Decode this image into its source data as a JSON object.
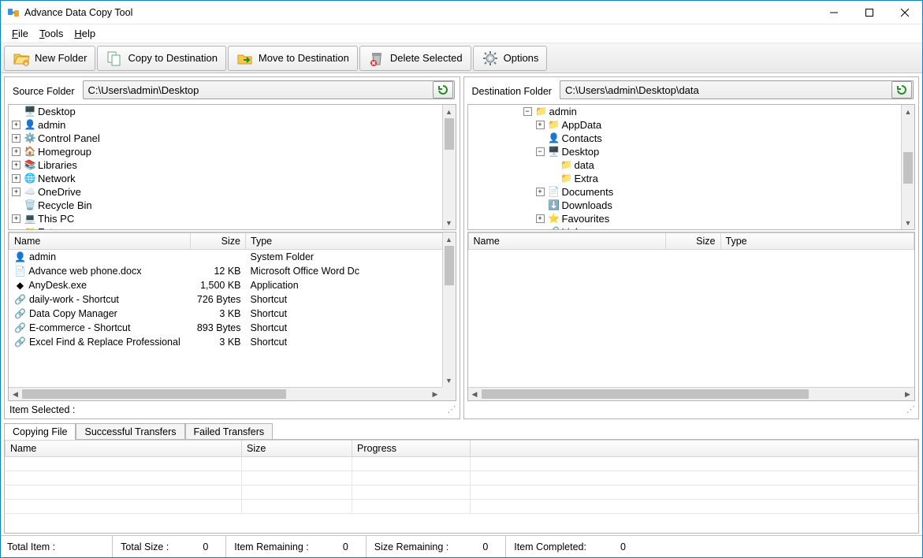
{
  "title": "Advance Data Copy Tool",
  "menu": {
    "file": "File",
    "tools": "Tools",
    "help": "Help"
  },
  "toolbar": {
    "new_folder": "New Folder",
    "copy": "Copy to Destination",
    "move": "Move to Destination",
    "delete": "Delete Selected",
    "options": "Options"
  },
  "source": {
    "label": "Source Folder",
    "path": "C:\\Users\\admin\\Desktop",
    "tree": [
      {
        "icon": "monitor",
        "label": "Desktop",
        "exp": ""
      },
      {
        "icon": "user",
        "label": "admin",
        "exp": "+"
      },
      {
        "icon": "cpanel",
        "label": "Control Panel",
        "exp": "+"
      },
      {
        "icon": "home",
        "label": "Homegroup",
        "exp": "+"
      },
      {
        "icon": "lib",
        "label": "Libraries",
        "exp": "+"
      },
      {
        "icon": "net",
        "label": "Network",
        "exp": "+"
      },
      {
        "icon": "cloud",
        "label": "OneDrive",
        "exp": "+"
      },
      {
        "icon": "bin",
        "label": "Recycle Bin",
        "exp": ""
      },
      {
        "icon": "pc",
        "label": "This PC",
        "exp": "+"
      },
      {
        "icon": "folder",
        "label": "Extra",
        "exp": ""
      }
    ],
    "columns": {
      "name": "Name",
      "size": "Size",
      "type": "Type"
    },
    "rows": [
      {
        "icon": "user",
        "name": "admin",
        "size": "",
        "type": "System Folder"
      },
      {
        "icon": "docx",
        "name": "Advance web phone.docx",
        "size": "12 KB",
        "type": "Microsoft Office Word Dc"
      },
      {
        "icon": "exe",
        "name": "AnyDesk.exe",
        "size": "1,500 KB",
        "type": "Application"
      },
      {
        "icon": "lnk",
        "name": "daily-work - Shortcut",
        "size": "726 Bytes",
        "type": "Shortcut"
      },
      {
        "icon": "lnk",
        "name": "Data Copy Manager",
        "size": "3 KB",
        "type": "Shortcut"
      },
      {
        "icon": "lnk",
        "name": "E-commerce - Shortcut",
        "size": "893 Bytes",
        "type": "Shortcut"
      },
      {
        "icon": "lnk",
        "name": "Excel Find & Replace Professional",
        "size": "3 KB",
        "type": "Shortcut"
      }
    ],
    "status": "Item Selected :"
  },
  "dest": {
    "label": "Destination Folder",
    "path": "C:\\Users\\admin\\Desktop\\data",
    "tree_root": "admin",
    "tree_children": [
      "AppData",
      "Contacts",
      "Desktop",
      "Documents",
      "Downloads",
      "Favourites",
      "Links"
    ],
    "desktop_children": [
      "data",
      "Extra"
    ],
    "columns": {
      "name": "Name",
      "size": "Size",
      "type": "Type"
    }
  },
  "tabs": {
    "copying": "Copying File",
    "success": "Successful Transfers",
    "failed": "Failed Transfers"
  },
  "transfer_cols": {
    "name": "Name",
    "size": "Size",
    "progress": "Progress"
  },
  "footer": {
    "total_item_label": "Total Item :",
    "total_item": "",
    "total_size_label": "Total Size :",
    "total_size": "0",
    "remaining_label": "Item Remaining :",
    "remaining": "0",
    "size_remaining_label": "Size Remaining :",
    "size_remaining": "0",
    "completed_label": "Item Completed:",
    "completed": "0"
  }
}
